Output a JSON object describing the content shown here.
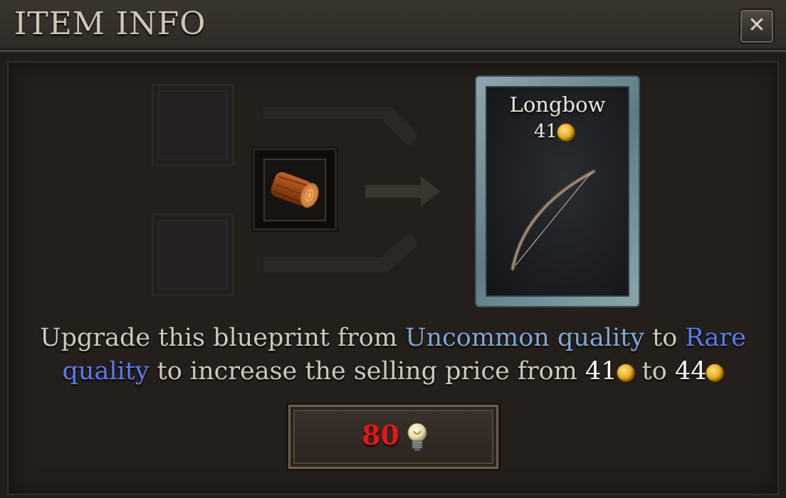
{
  "window": {
    "title": "ITEM INFO",
    "close_label": "✕"
  },
  "recipe": {
    "ingredient_icon": "wood-log-icon",
    "result": {
      "name": "Longbow",
      "price": "41",
      "icon": "longbow-icon",
      "currency_icon": "gold-coin-icon"
    }
  },
  "description": {
    "part1": "Upgrade this blueprint from ",
    "from_quality": "Uncommon quality",
    "part2": " to ",
    "to_quality": "Rare quality",
    "part3": " to increase the selling price from ",
    "from_price": "41",
    "part4": " to ",
    "to_price": "44"
  },
  "upgrade_button": {
    "cost": "80",
    "cost_icon": "lightbulb-icon"
  },
  "colors": {
    "uncommon": "#7fa8d6",
    "rare": "#5b7cf0",
    "cost": "#e01818"
  }
}
